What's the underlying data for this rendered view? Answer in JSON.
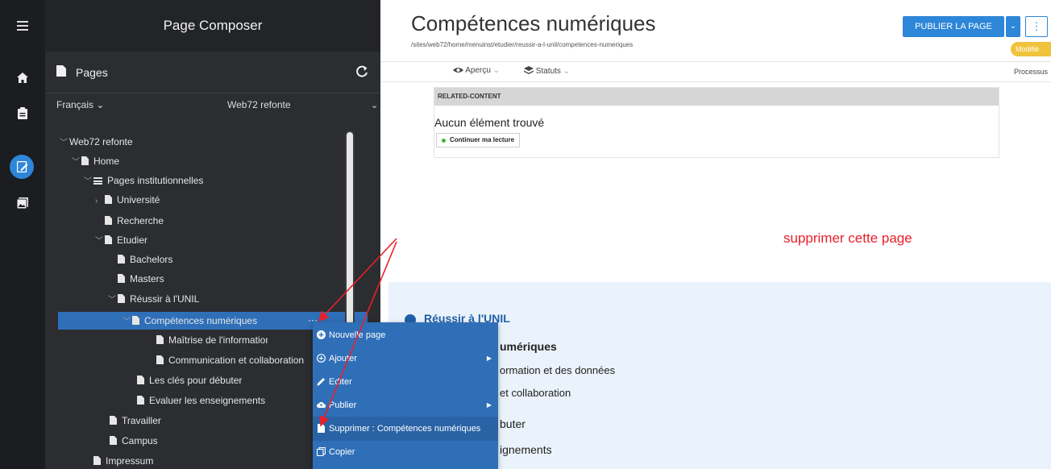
{
  "composer": {
    "title": "Page Composer",
    "pages_title": "Pages",
    "language": "Français ⌄",
    "site": "Web72 refonte",
    "site_chevron": "⌄",
    "more_label": "···"
  },
  "tree": [
    {
      "label": "Web72 refonte",
      "chevron": "﹀",
      "icon": "none"
    },
    {
      "label": "Home",
      "chevron": "﹀",
      "icon": "page"
    },
    {
      "label": "Pages institutionnelles",
      "chevron": "﹀",
      "icon": "list"
    },
    {
      "label": "Université",
      "chevron": "›",
      "icon": "page"
    },
    {
      "label": "Recherche",
      "chevron": "",
      "icon": "page"
    },
    {
      "label": "Etudier",
      "chevron": "﹀",
      "icon": "page"
    },
    {
      "label": "Bachelors",
      "chevron": "",
      "icon": "page"
    },
    {
      "label": "Masters",
      "chevron": "",
      "icon": "page"
    },
    {
      "label": "Réussir à l'UNIL",
      "chevron": "﹀",
      "icon": "page"
    },
    {
      "label": "Compétences numériques",
      "chevron": "﹀",
      "icon": "page"
    },
    {
      "label": "Maîtrise de l'information et des d",
      "chevron": "",
      "icon": "page"
    },
    {
      "label": "Communication et collaboration",
      "chevron": "",
      "icon": "page"
    },
    {
      "label": "Les clés pour débuter",
      "chevron": "",
      "icon": "page"
    },
    {
      "label": "Evaluer les enseignements",
      "chevron": "",
      "icon": "page"
    },
    {
      "label": "Travailler",
      "chevron": "",
      "icon": "page"
    },
    {
      "label": "Campus",
      "chevron": "",
      "icon": "page"
    },
    {
      "label": "Impressum",
      "chevron": "",
      "icon": "page"
    }
  ],
  "context_menu": [
    {
      "label": "Nouvelle page",
      "icon": "plus-circle-icon",
      "submenu": ""
    },
    {
      "label": "Ajouter",
      "icon": "plus-outline-icon",
      "submenu": "▶"
    },
    {
      "label": "Editer",
      "icon": "pencil-icon",
      "submenu": ""
    },
    {
      "label": "Publier",
      "icon": "cloud-upload-icon",
      "submenu": "▶"
    },
    {
      "label": "Supprimer : Compétences numériques",
      "icon": "delete-page-icon",
      "submenu": ""
    },
    {
      "label": "Copier",
      "icon": "copy-icon",
      "submenu": ""
    }
  ],
  "main": {
    "title": "Compétences numériques",
    "path": "/sites/web72/home/menuinst/etudier/reussir-a-l-unil/competences-numeriques",
    "publish": "PUBLIER LA PAGE",
    "publish_dd": "⌄",
    "more": "⋮",
    "status": "Modifié",
    "apercu": "Aperçu",
    "statuts": "Statuts",
    "chevron": "⌄",
    "process": "Processus",
    "related_header": "RELATED-CONTENT",
    "no_item": "Aucun élément trouvé",
    "continue": "Continuer ma lecture",
    "annotation": "supprimer cette page",
    "breadcrumb": "Réussir à l'UNIL",
    "preview_lines": [
      "umériques",
      "ormation et des données",
      "et collaboration",
      "buter",
      "ignements"
    ]
  },
  "colors": {
    "accent": "#2e86d8",
    "selection": "#2f6fb8",
    "annotation": "#e8202a",
    "badge": "#f0c33c"
  }
}
